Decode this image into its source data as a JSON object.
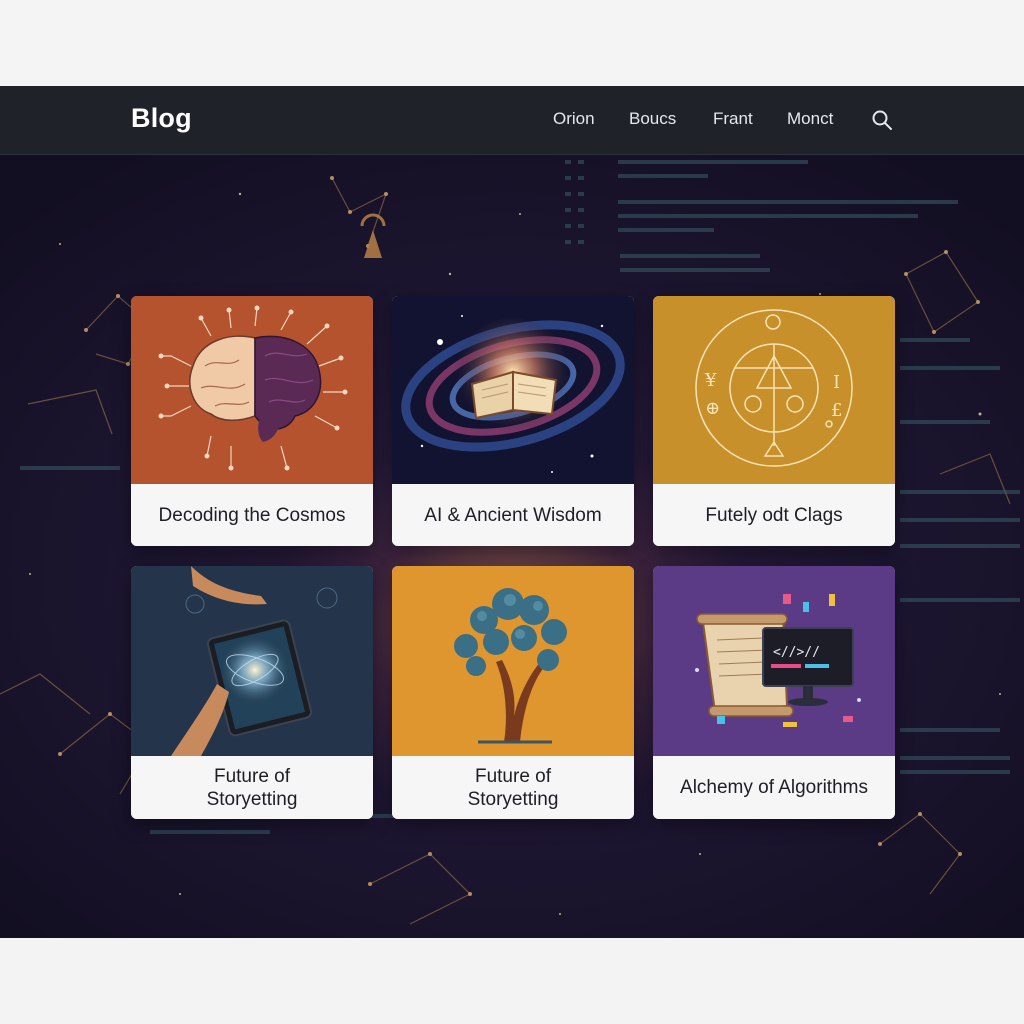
{
  "nav": {
    "brand": "Blog",
    "links": [
      "Orion",
      "Boucs",
      "Frant",
      "Monct"
    ],
    "search_icon": "search-icon"
  },
  "cards": [
    {
      "title": "Decoding the Cosmos",
      "image": "brain-circuit-icon",
      "color": "#b4532d"
    },
    {
      "title": "AI & Ancient Wisdom",
      "image": "galaxy-book-icon",
      "color": "#1a1836"
    },
    {
      "title": "Futely odt Clags",
      "image": "alchemy-symbol-icon",
      "color": "#c8902a"
    },
    {
      "title": "Future of\nStoryetting",
      "image": "tablet-hands-icon",
      "color": "#24344a"
    },
    {
      "title": "Future of\nStoryetting",
      "image": "tree-icon",
      "color": "#e0962e"
    },
    {
      "title": "Alchemy of Algorithms",
      "image": "scroll-code-icon",
      "color": "#5b3a86"
    }
  ]
}
